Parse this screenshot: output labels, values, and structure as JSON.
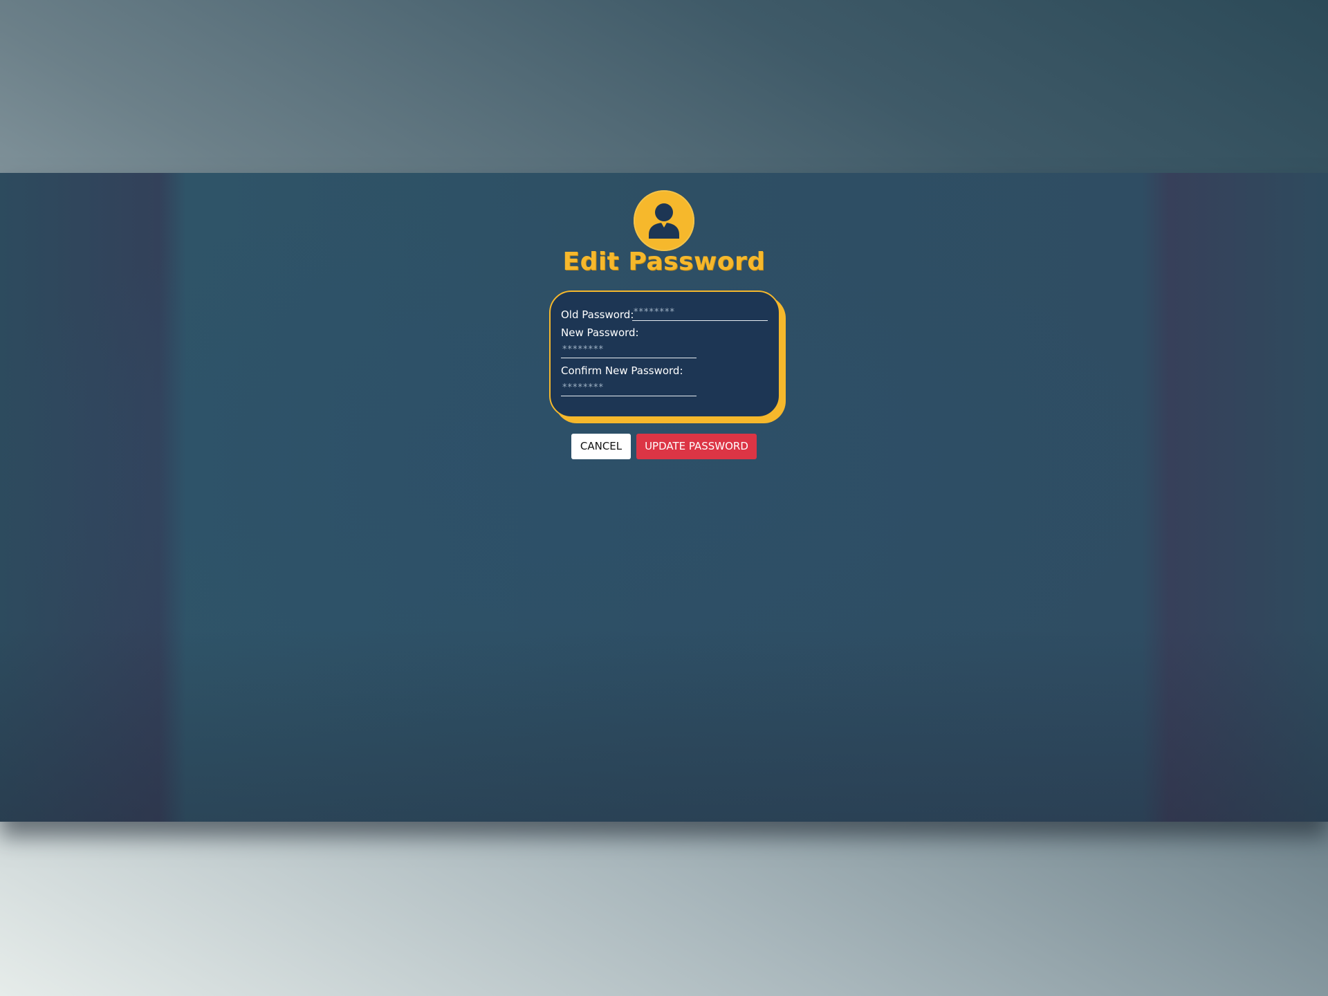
{
  "dialog": {
    "title": "Edit Password",
    "avatar_icon": "user-icon"
  },
  "form": {
    "old_password": {
      "label": "Old Password:",
      "value": "********"
    },
    "new_password": {
      "label": "New Password:",
      "value": "********"
    },
    "confirm_password": {
      "label": "Confirm New Password:",
      "value": "********"
    }
  },
  "actions": {
    "cancel_label": "CANCEL",
    "update_label": "UPDATE PASSWORD"
  },
  "colors": {
    "accent": "#f6b82c",
    "card_bg": "#1d3654",
    "danger": "#dc3545"
  }
}
